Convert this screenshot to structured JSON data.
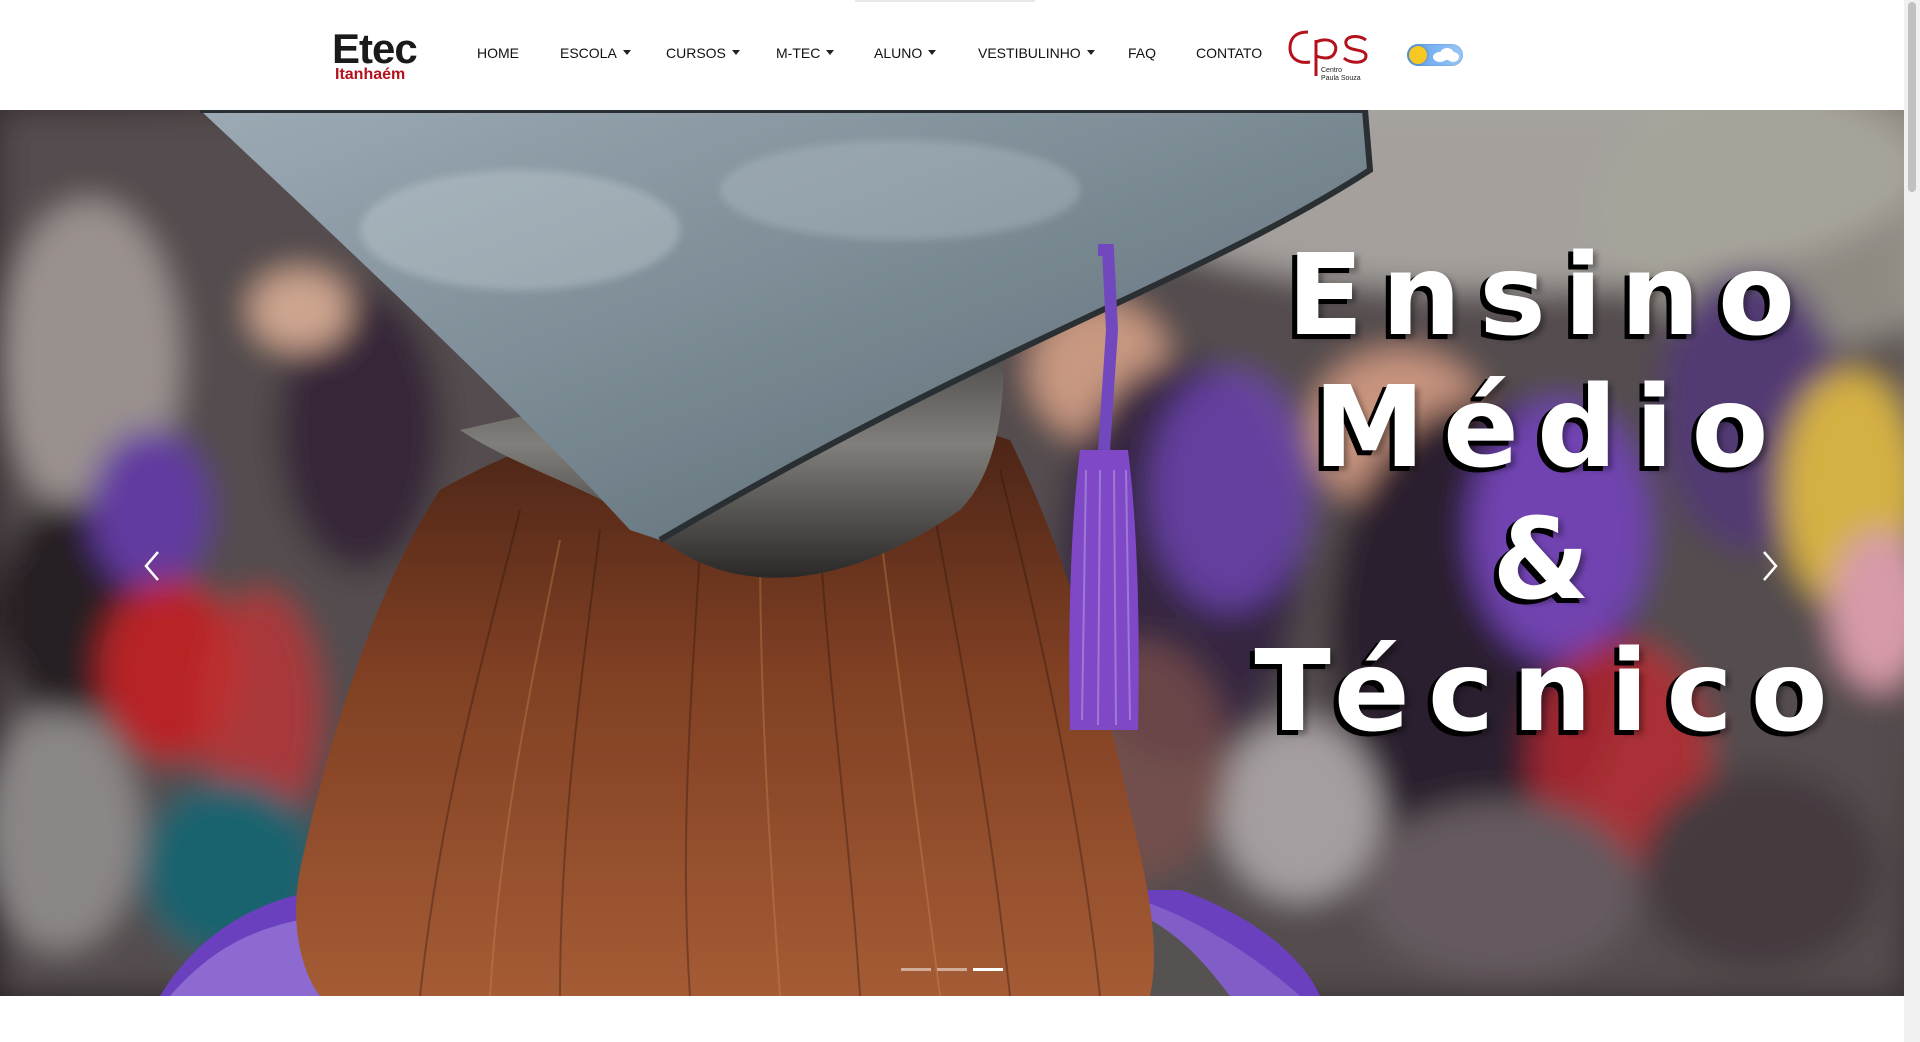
{
  "brand": {
    "name": "Etec",
    "location": "Itanhaém"
  },
  "nav": {
    "items": [
      {
        "label": "HOME",
        "dropdown": false
      },
      {
        "label": "ESCOLA",
        "dropdown": true
      },
      {
        "label": "CURSOS",
        "dropdown": true
      },
      {
        "label": "M-TEC",
        "dropdown": true
      },
      {
        "label": "ALUNO",
        "dropdown": true
      },
      {
        "label": "VESTIBULINHO",
        "dropdown": true
      },
      {
        "label": "FAQ",
        "dropdown": false
      },
      {
        "label": "CONTATO",
        "dropdown": false
      }
    ]
  },
  "partner_logo": {
    "initials": "cps",
    "line1": "Centro",
    "line2": "Paula Souza",
    "color": "#b3121c"
  },
  "theme_toggle": {
    "state": "light",
    "icons": [
      "sun-icon",
      "cloud-icon"
    ]
  },
  "hero": {
    "title_lines": [
      "Ensino",
      "Médio",
      "&",
      "Técnico"
    ],
    "prev_icon": "chevron-left-icon",
    "next_icon": "chevron-right-icon",
    "slides_total": 3,
    "active_slide": 3
  },
  "colors": {
    "accent": "#b3121c",
    "text": "#111111",
    "tassel": "#8a4fd8"
  }
}
